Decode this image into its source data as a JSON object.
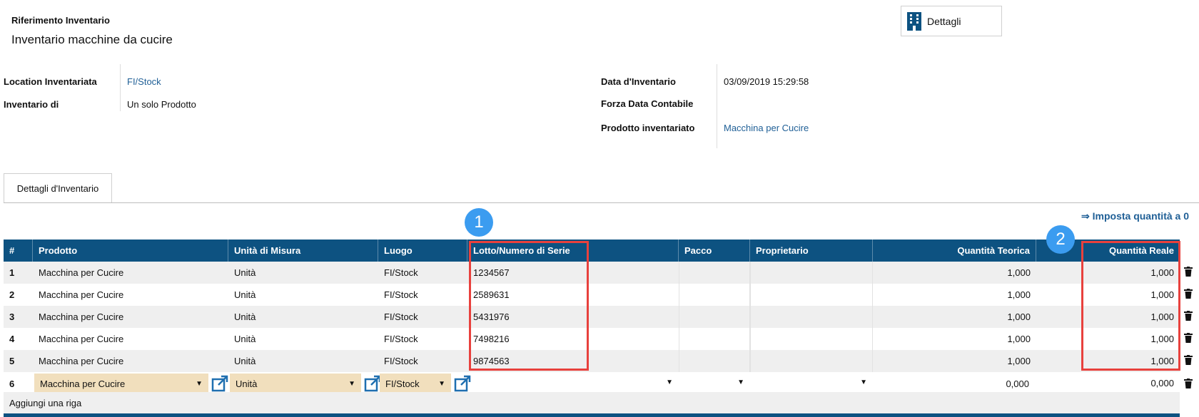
{
  "header": {
    "ref_label": "Riferimento Inventario",
    "title": "Inventario macchine da cucire",
    "details_button": "Dettagli"
  },
  "form": {
    "location_label": "Location Inventariata",
    "location_value": "FI/Stock",
    "inventario_di_label": "Inventario di",
    "inventario_di_value": "Un solo Prodotto",
    "data_label": "Data d'Inventario",
    "data_value": "03/09/2019 15:29:58",
    "forza_label": "Forza Data Contabile",
    "prodotto_label": "Prodotto inventariato",
    "prodotto_value": "Macchina per Cucire"
  },
  "tabs": {
    "active": "Dettagli d'Inventario"
  },
  "actions": {
    "imposta": "⇒ Imposta quantità a 0",
    "add_row": "Aggiungi una riga"
  },
  "table": {
    "headers": {
      "num": "#",
      "prodotto": "Prodotto",
      "unita": "Unità di Misura",
      "luogo": "Luogo",
      "lotto": "Lotto/Numero di Serie",
      "pacco": "Pacco",
      "proprietario": "Proprietario",
      "teorica": "Quantità Teorica",
      "reale": "Quantità Reale"
    },
    "rows": [
      {
        "num": "1",
        "prodotto": "Macchina per Cucire",
        "unita": "Unità",
        "luogo": "FI/Stock",
        "lotto": "1234567",
        "teorica": "1,000",
        "reale": "1,000"
      },
      {
        "num": "2",
        "prodotto": "Macchina per Cucire",
        "unita": "Unità",
        "luogo": "FI/Stock",
        "lotto": "2589631",
        "teorica": "1,000",
        "reale": "1,000"
      },
      {
        "num": "3",
        "prodotto": "Macchina per Cucire",
        "unita": "Unità",
        "luogo": "FI/Stock",
        "lotto": "5431976",
        "teorica": "1,000",
        "reale": "1,000"
      },
      {
        "num": "4",
        "prodotto": "Macchina per Cucire",
        "unita": "Unità",
        "luogo": "FI/Stock",
        "lotto": "7498216",
        "teorica": "1,000",
        "reale": "1,000"
      },
      {
        "num": "5",
        "prodotto": "Macchina per Cucire",
        "unita": "Unità",
        "luogo": "FI/Stock",
        "lotto": "9874563",
        "teorica": "1,000",
        "reale": "1,000"
      }
    ],
    "edit_row": {
      "num": "6",
      "prodotto": "Macchina per Cucire",
      "unita": "Unità",
      "luogo": "FI/Stock",
      "teorica": "0,000",
      "reale": "0,000"
    }
  },
  "annotations": {
    "badge1": "1",
    "badge2": "2"
  },
  "colors": {
    "header_bg": "#0d5281",
    "link": "#1f5f96",
    "badge": "#3b9cf0",
    "highlight": "#e8413d",
    "select_bg": "#f1dfbd"
  }
}
